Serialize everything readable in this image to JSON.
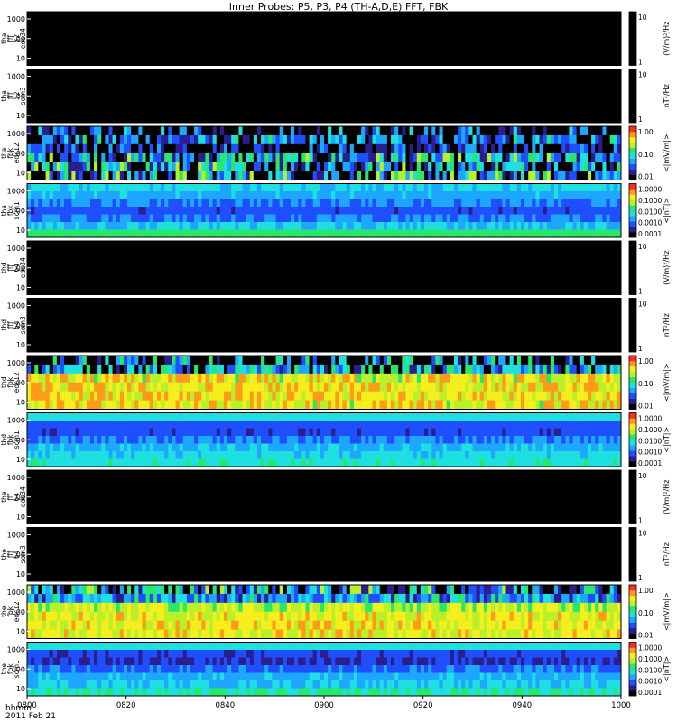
{
  "title": "Inner Probes: P5, P3, P4 (TH-A,D,E) FFT, FBK",
  "time_axis": {
    "ticks": [
      "0800",
      "0820",
      "0840",
      "0900",
      "0920",
      "0940",
      "1000"
    ],
    "label_format": "hhmm",
    "date": "2011 Feb 21"
  },
  "colors": {
    "background": "#000000",
    "separator": "#ffffff",
    "ramp": [
      "#000000",
      "#2b1f8f",
      "#1f4fff",
      "#1ea7ff",
      "#1fe0e0",
      "#27e86a",
      "#b9f02a",
      "#f5ef1e",
      "#ff9a1a",
      "#ff2d1a"
    ]
  },
  "chart_data": [
    {
      "type": "heatmap",
      "probe": "tha",
      "instrument": "fff_32",
      "channel": "edc34",
      "ylabel": [
        "tha",
        "fff",
        "32",
        "edc34"
      ],
      "y_ticks": [
        "1000",
        "100",
        "10"
      ],
      "colorbar_label": "(V/m)²/Hz",
      "colorbar_ticks": [
        "10",
        "1"
      ],
      "data_present": false
    },
    {
      "type": "heatmap",
      "probe": "tha",
      "instrument": "fff_32",
      "channel": "scm3",
      "ylabel": [
        "tha",
        "fff",
        "32",
        "scm3"
      ],
      "y_ticks": [
        "1000",
        "100",
        "10"
      ],
      "colorbar_label": "nT²/Hz",
      "colorbar_ticks": [
        "10",
        "1"
      ],
      "data_present": false
    },
    {
      "type": "heatmap",
      "probe": "tha",
      "instrument": "fbk",
      "channel": "edc12",
      "ylabel": [
        "tha",
        "fbk",
        "edc12"
      ],
      "y_ticks": [
        "1000",
        "100",
        "10"
      ],
      "colorbar_label": "<|mV/m|>",
      "colorbar_ticks": [
        "1.00",
        "0.10",
        "0.01"
      ],
      "data_present": true,
      "bands": [
        {
          "level": 0.0,
          "flicker": 0.5
        },
        {
          "level": 0.22,
          "flicker": 0.3
        },
        {
          "level": 0.12,
          "flicker": 0.25
        },
        {
          "level": 0.3,
          "flicker": 0.35
        },
        {
          "level": 0.28,
          "flicker": 0.4
        },
        {
          "level": 0.25,
          "flicker": 0.45
        }
      ]
    },
    {
      "type": "heatmap",
      "probe": "tha",
      "instrument": "fbk",
      "channel": "scm1",
      "ylabel": [
        "tha",
        "fbk",
        "scm1"
      ],
      "y_ticks": [
        "1000",
        "100",
        "10"
      ],
      "colorbar_label": "<|nT|>",
      "colorbar_ticks": [
        "1.0000",
        "0.1000",
        "0.0100",
        "0.0010",
        "0.0001"
      ],
      "data_present": true,
      "bands": [
        {
          "level": 0.42,
          "flicker": 0.05
        },
        {
          "level": 0.36,
          "flicker": 0.05
        },
        {
          "level": 0.3,
          "flicker": 0.05
        },
        {
          "level": 0.24,
          "flicker": 0.05
        },
        {
          "level": 0.3,
          "flicker": 0.05
        },
        {
          "level": 0.4,
          "flicker": 0.08
        },
        {
          "level": 0.55,
          "flicker": 0.05
        }
      ]
    },
    {
      "type": "heatmap",
      "probe": "thd",
      "instrument": "fff_64",
      "channel": "edc34",
      "ylabel": [
        "thd",
        "fff",
        "64",
        "edc34"
      ],
      "y_ticks": [
        "1000",
        "100",
        "10"
      ],
      "colorbar_label": "(V/m)²/Hz",
      "colorbar_ticks": [
        "10",
        "1"
      ],
      "data_present": false
    },
    {
      "type": "heatmap",
      "probe": "thd",
      "instrument": "fff_64",
      "channel": "scm3",
      "ylabel": [
        "thd",
        "fff",
        "64",
        "scm3"
      ],
      "y_ticks": [
        "1000",
        "100",
        "10"
      ],
      "colorbar_label": "nT²/Hz",
      "colorbar_ticks": [
        "10",
        "1"
      ],
      "data_present": false
    },
    {
      "type": "heatmap",
      "probe": "thd",
      "instrument": "fbk",
      "channel": "edc12",
      "ylabel": [
        "thd",
        "fbk",
        "edc12"
      ],
      "y_ticks": [
        "1000",
        "100",
        "10"
      ],
      "colorbar_label": "<|mV/m|>",
      "colorbar_ticks": [
        "1.00",
        "0.10",
        "0.01"
      ],
      "data_present": true,
      "bands": [
        {
          "level": 0.0,
          "flicker": 0.6
        },
        {
          "level": 0.3,
          "flicker": 0.3
        },
        {
          "level": 0.72,
          "flicker": 0.15
        },
        {
          "level": 0.74,
          "flicker": 0.12
        },
        {
          "level": 0.76,
          "flicker": 0.12
        },
        {
          "level": 0.74,
          "flicker": 0.15
        }
      ]
    },
    {
      "type": "heatmap",
      "probe": "thd",
      "instrument": "fbk",
      "channel": "scm1",
      "ylabel": [
        "thd",
        "fbk",
        "scm1"
      ],
      "y_ticks": [
        "1000",
        "100",
        "10"
      ],
      "colorbar_label": "<|nT|>",
      "colorbar_ticks": [
        "1.0000",
        "0.1000",
        "0.0100",
        "0.0010",
        "0.0001"
      ],
      "data_present": true,
      "bands": [
        {
          "level": 0.45,
          "flicker": 0.03
        },
        {
          "level": 0.25,
          "flicker": 0.03
        },
        {
          "level": 0.22,
          "flicker": 0.03
        },
        {
          "level": 0.3,
          "flicker": 0.05
        },
        {
          "level": 0.38,
          "flicker": 0.06
        },
        {
          "level": 0.44,
          "flicker": 0.06
        },
        {
          "level": 0.46,
          "flicker": 0.06
        }
      ]
    },
    {
      "type": "heatmap",
      "probe": "the",
      "instrument": "fff_64",
      "channel": "edc34",
      "ylabel": [
        "the",
        "fff",
        "64",
        "edc34"
      ],
      "y_ticks": [
        "1000",
        "100",
        "10"
      ],
      "colorbar_label": "(V/m)²/Hz",
      "colorbar_ticks": [
        "10",
        "1"
      ],
      "data_present": false
    },
    {
      "type": "heatmap",
      "probe": "the",
      "instrument": "fff_64",
      "channel": "scm3",
      "ylabel": [
        "the",
        "fff",
        "64",
        "scm3"
      ],
      "y_ticks": [
        "1000",
        "100",
        "10"
      ],
      "colorbar_label": "nT²/Hz",
      "colorbar_ticks": [
        "10",
        "1"
      ],
      "data_present": false
    },
    {
      "type": "heatmap",
      "probe": "the",
      "instrument": "fbk",
      "channel": "edc12",
      "ylabel": [
        "the",
        "fbk",
        "edc12"
      ],
      "y_ticks": [
        "1000",
        "100",
        "10"
      ],
      "colorbar_label": "<|mV/m|>",
      "colorbar_ticks": [
        "1.00",
        "0.10",
        "0.01"
      ],
      "data_present": true,
      "bands": [
        {
          "level": 0.28,
          "flicker": 0.4
        },
        {
          "level": 0.35,
          "flicker": 0.2
        },
        {
          "level": 0.66,
          "flicker": 0.12
        },
        {
          "level": 0.72,
          "flicker": 0.1
        },
        {
          "level": 0.74,
          "flicker": 0.1
        },
        {
          "level": 0.72,
          "flicker": 0.12
        }
      ]
    },
    {
      "type": "heatmap",
      "probe": "the",
      "instrument": "fbk",
      "channel": "scm1",
      "ylabel": [
        "the",
        "fbk",
        "scm1"
      ],
      "y_ticks": [
        "1000",
        "100",
        "10"
      ],
      "colorbar_label": "<|nT|>",
      "colorbar_ticks": [
        "1.0000",
        "0.1000",
        "0.0100",
        "0.0010",
        "0.0001"
      ],
      "data_present": true,
      "bands": [
        {
          "level": 0.45,
          "flicker": 0.03
        },
        {
          "level": 0.22,
          "flicker": 0.03
        },
        {
          "level": 0.2,
          "flicker": 0.03
        },
        {
          "level": 0.28,
          "flicker": 0.05
        },
        {
          "level": 0.36,
          "flicker": 0.06
        },
        {
          "level": 0.42,
          "flicker": 0.06
        },
        {
          "level": 0.5,
          "flicker": 0.06
        }
      ]
    }
  ]
}
